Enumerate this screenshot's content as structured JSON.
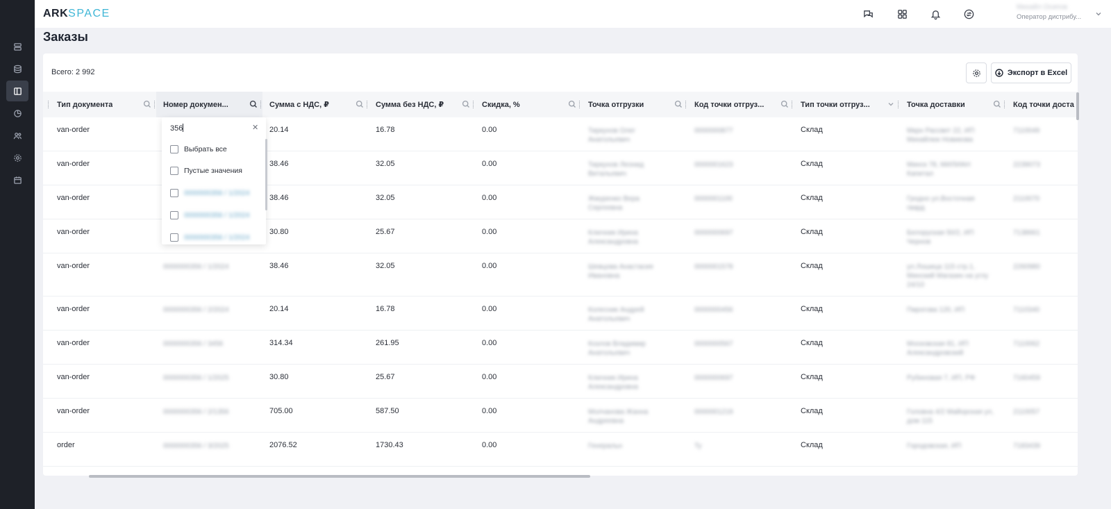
{
  "app": {
    "logo_ark": "ARK",
    "logo_space": "SPACE"
  },
  "user": {
    "name": "Михайл Осипов",
    "role": "Оператор дистрибу..."
  },
  "page": {
    "title": "Заказы",
    "total_label": "Всего: 2 992"
  },
  "toolbar": {
    "export_label": "Экспорт в Excel"
  },
  "columns": [
    "Тип документа",
    "Номер докумен...",
    "Сумма с НДС, ₽",
    "Сумма без НДС, ₽",
    "Скидка, %",
    "Точка отгрузки",
    "Код точки отгруз...",
    "Тип точки отгруз...",
    "Точка доставки",
    "Код точки доста"
  ],
  "filter_dropdown": {
    "search_value": "356",
    "options": [
      "Выбрать все",
      "Пустые значения"
    ],
    "blurred_options": [
      "0000000356 / 1/2024",
      "0000000356 / 1/2024",
      "0000000356 / 1/2024"
    ]
  },
  "rows": [
    {
      "type": "van-order",
      "number": "",
      "sum_vat": "20.14",
      "sum_no_vat": "16.78",
      "discount": "0.00",
      "ship_point": "Тиркунов Олег Анатольевич",
      "ship_code": "0000000877",
      "ship_type": "Склад",
      "delivery": "Мкрн Рассвет 22, ИП Михайлюк Новикова",
      "delivery_code": "7110049"
    },
    {
      "type": "van-order",
      "number": "",
      "sum_vat": "38.46",
      "sum_no_vat": "32.05",
      "discount": "0.00",
      "ship_point": "Тиркунов Леонид Витальевич",
      "ship_code": "0000001623",
      "ship_type": "Склад",
      "delivery": "Минск 78, МИЛИАН Капитал",
      "delivery_code": "2239073"
    },
    {
      "type": "van-order",
      "number": "",
      "sum_vat": "38.46",
      "sum_no_vat": "32.05",
      "discount": "0.00",
      "ship_point": "Жмуренко Вера Сергеевна",
      "ship_code": "0000001100",
      "ship_type": "Склад",
      "delivery": "Гродно ул.Восточная гвард",
      "delivery_code": "2110070"
    },
    {
      "type": "van-order",
      "number": "",
      "sum_vat": "30.80",
      "sum_no_vat": "25.67",
      "discount": "0.00",
      "ship_point": "Ключник Ирина Александровна",
      "ship_code": "0000000697",
      "ship_type": "Склад",
      "delivery": "Белоруская 50/2, ИП Чернов",
      "delivery_code": "7138661"
    },
    {
      "type": "van-order",
      "number": "0000000356 / 1/2024",
      "sum_vat": "38.46",
      "sum_no_vat": "32.05",
      "discount": "0.00",
      "ship_point": "Шевцова Анастасия Ивановна",
      "ship_code": "0000001578",
      "ship_type": "Склад",
      "delivery": "ул.Лошица 115 стр.1, Минский Магазин на углу 24/10",
      "delivery_code": "2260980"
    },
    {
      "type": "van-order",
      "number": "0000000356 / 2/2024",
      "sum_vat": "20.14",
      "sum_no_vat": "16.78",
      "discount": "0.00",
      "ship_point": "Колесник Андрей Анатольевич",
      "ship_code": "0000000456",
      "ship_type": "Склад",
      "delivery": "Пирогова 120, ИП",
      "delivery_code": "7110340"
    },
    {
      "type": "van-order",
      "number": "0000000356 / 3456",
      "sum_vat": "314.34",
      "sum_no_vat": "261.95",
      "discount": "0.00",
      "ship_point": "Козлов Владимир Анатольевич",
      "ship_code": "0000000567",
      "ship_type": "Склад",
      "delivery": "Московская 81, ИП Александровский",
      "delivery_code": "7110062"
    },
    {
      "type": "van-order",
      "number": "0000000356 / 1/2025",
      "sum_vat": "30.80",
      "sum_no_vat": "25.67",
      "discount": "0.00",
      "ship_point": "Ключник Ирина Александровна",
      "ship_code": "0000000697",
      "ship_type": "Склад",
      "delivery": "Рубиновая 7, ИП, РФ",
      "delivery_code": "7160459"
    },
    {
      "type": "van-order",
      "number": "0000000356 / 2/1356",
      "sum_vat": "705.00",
      "sum_no_vat": "587.50",
      "discount": "0.00",
      "ship_point": "Молчанова Жанна Андреевна",
      "ship_code": "0000001219",
      "ship_type": "Склад",
      "delivery": "Головна 4/2 Майорская ул, дом 115",
      "delivery_code": "2110057"
    },
    {
      "type": "order",
      "number": "0000000356 / 3/2025",
      "sum_vat": "2076.52",
      "sum_no_vat": "1730.43",
      "discount": "0.00",
      "ship_point": "Генеральн",
      "ship_code": "Ту",
      "ship_type": "Склад",
      "delivery": "Городовская, ИП",
      "delivery_code": "7183439"
    }
  ]
}
